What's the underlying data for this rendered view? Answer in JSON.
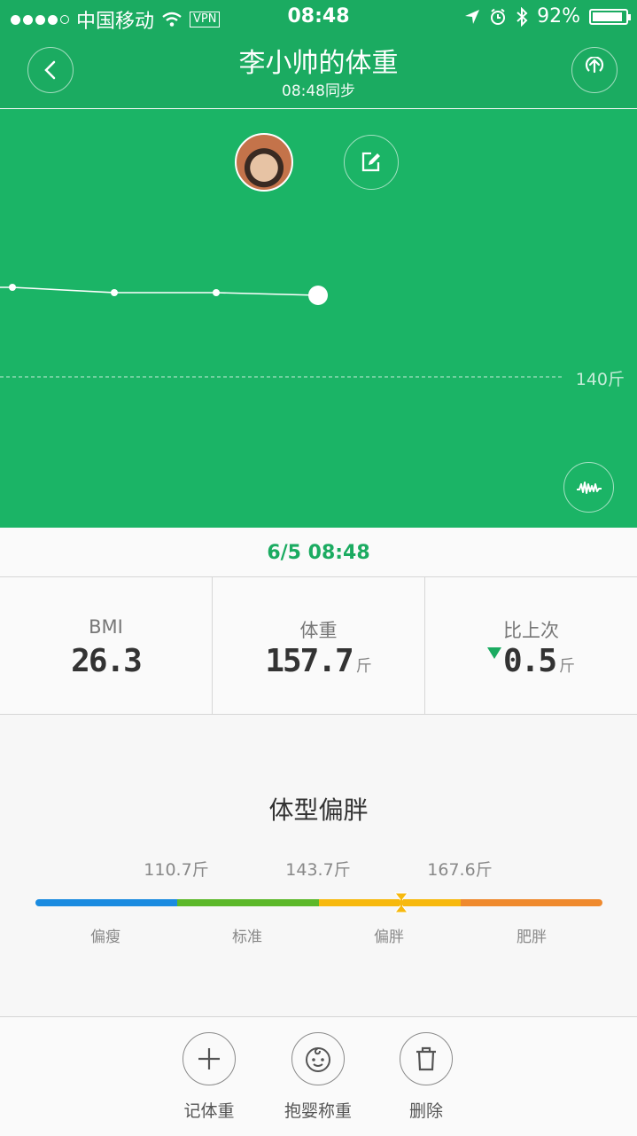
{
  "status_bar": {
    "carrier": "中国移动",
    "vpn": "VPN",
    "time": "08:48",
    "battery_percent": "92%",
    "battery_level": 0.92
  },
  "header": {
    "title": "李小帅的体重",
    "subtitle": "08:48同步",
    "back_icon": "chevron-left-icon",
    "share_icon": "upload-icon"
  },
  "chart": {
    "reference_label": "140斤",
    "edit_icon": "edit-icon",
    "trend_icon": "waveform-icon"
  },
  "chart_data": {
    "type": "line",
    "reference_line": {
      "value": 140,
      "label": "140斤"
    }
  },
  "measurement": {
    "date": "6/5 08:48"
  },
  "stats": [
    {
      "label": "BMI",
      "value": "26.3",
      "unit": ""
    },
    {
      "label": "体重",
      "value": "157.7",
      "unit": "斤"
    },
    {
      "label": "比上次",
      "value": "0.5",
      "unit": "斤",
      "trend": "down"
    }
  ],
  "body_type": {
    "title": "体型偏胖",
    "thresholds": [
      "110.7斤",
      "143.7斤",
      "167.6斤"
    ],
    "categories": [
      "偏瘦",
      "标准",
      "偏胖",
      "肥胖"
    ],
    "colors": [
      "#1a8be0",
      "#5cb82a",
      "#f7b90e",
      "#ef8a2e"
    ],
    "current_category": "偏胖"
  },
  "toolbar": [
    {
      "label": "记体重",
      "icon": "plus-icon"
    },
    {
      "label": "抱婴称重",
      "icon": "baby-face-icon"
    },
    {
      "label": "删除",
      "icon": "trash-icon"
    }
  ],
  "colors": {
    "brand_green": "#1bab61",
    "chart_green": "#1bb466"
  }
}
